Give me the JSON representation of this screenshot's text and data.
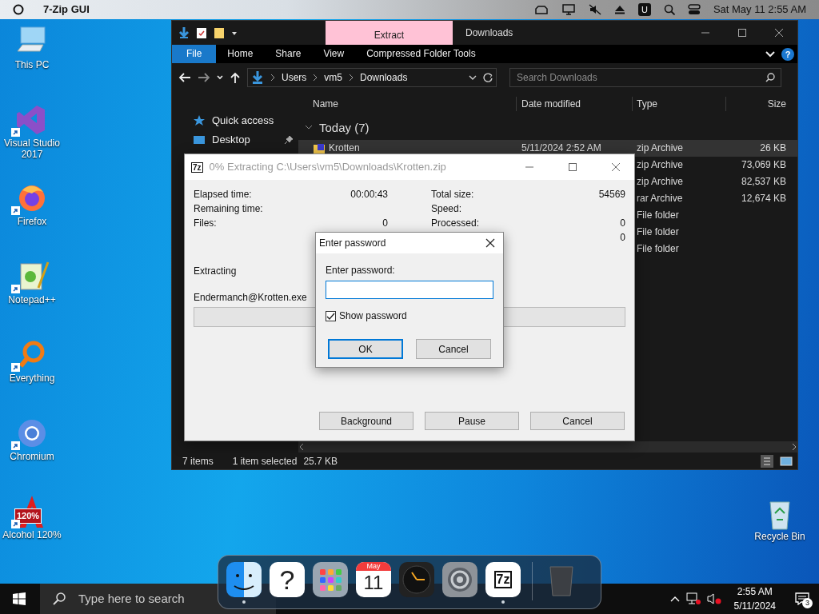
{
  "menubar": {
    "app_name": "7-Zip GUI",
    "badge_letter": "U",
    "clock": "Sat May 11 2:55 AM"
  },
  "desktop_icons": [
    {
      "label": "This PC",
      "kind": "pc",
      "shortcut": false
    },
    {
      "label": "Visual Studio 2017",
      "kind": "vs",
      "shortcut": true
    },
    {
      "label": "Firefox",
      "kind": "firefox",
      "shortcut": true
    },
    {
      "label": "Notepad++",
      "kind": "notepad",
      "shortcut": true
    },
    {
      "label": "Everything",
      "kind": "everything",
      "shortcut": true
    },
    {
      "label": "Chromium",
      "kind": "chromium",
      "shortcut": true
    },
    {
      "label": "Alcohol 120%",
      "kind": "alcohol",
      "shortcut": true,
      "logo_text": "120%"
    }
  ],
  "recycle_bin": {
    "label": "Recycle Bin"
  },
  "explorer": {
    "context_tab": "Extract",
    "title": "Downloads",
    "ribbon_tabs": [
      {
        "label": "File",
        "kind": "file"
      },
      {
        "label": "Home",
        "kind": "tab"
      },
      {
        "label": "Share",
        "kind": "tab"
      },
      {
        "label": "View",
        "kind": "tab"
      },
      {
        "label": "Compressed Folder Tools",
        "kind": "tab"
      }
    ],
    "help_glyph": "?",
    "breadcrumb": [
      "Users",
      "vm5",
      "Downloads"
    ],
    "search": {
      "placeholder": "Search Downloads"
    },
    "nav": [
      {
        "label": "Quick access",
        "kind": "star",
        "pinned": false
      },
      {
        "label": "Desktop",
        "kind": "desktop",
        "pinned": true
      }
    ],
    "columns": [
      "Name",
      "Date modified",
      "Type",
      "Size"
    ],
    "group": "Today (7)",
    "rows": [
      {
        "name": "Krotten",
        "date": "5/11/2024 2:52 AM",
        "type": "zip Archive",
        "size": "26 KB",
        "selected": true
      },
      {
        "type": "zip Archive",
        "size": "73,069 KB",
        "selected": false
      },
      {
        "type": "zip Archive",
        "size": "82,537 KB",
        "selected": false
      },
      {
        "type": "rar Archive",
        "size": "12,674 KB",
        "selected": false
      },
      {
        "type": "File folder",
        "selected": false
      },
      {
        "type": "File folder",
        "selected": false
      },
      {
        "type": "File folder",
        "selected": false
      }
    ],
    "status": {
      "count": "7 items",
      "selection": "1 item selected",
      "size": "25.7 KB"
    }
  },
  "extract_dialog": {
    "icon_text": "7z",
    "title": "0% Extracting C:\\Users\\vm5\\Downloads\\Krotten.zip",
    "left_stats": [
      {
        "label": "Elapsed time:",
        "value": "00:00:43"
      },
      {
        "label": "Remaining time:"
      },
      {
        "label": "Files:",
        "value": "0"
      }
    ],
    "right_stats": [
      {
        "label": "Total size:",
        "value": "54569"
      },
      {
        "label": "Speed:"
      },
      {
        "label": "Processed:",
        "value": "0"
      },
      {
        "value": "0"
      }
    ],
    "operation": "Extracting",
    "file": "Endermanch@Krotten.exe",
    "progress": {
      "level": 0
    },
    "buttons": [
      "Background",
      "Pause",
      "Cancel"
    ]
  },
  "password_dialog": {
    "title": "Enter password",
    "label": "Enter password:",
    "show_password": {
      "label": "Show password",
      "checked": true
    },
    "buttons": [
      {
        "label": "OK",
        "default": true
      },
      {
        "label": "Cancel",
        "default": false
      }
    ]
  },
  "dock": {
    "items": [
      {
        "kind": "finder",
        "running": true
      },
      {
        "kind": "help",
        "glyph": "?",
        "running": false
      },
      {
        "kind": "launchpad",
        "running": false
      },
      {
        "kind": "calendar",
        "month": "May",
        "day": "11",
        "running": false
      },
      {
        "kind": "clock",
        "running": false
      },
      {
        "kind": "settings",
        "running": false
      },
      {
        "kind": "sevenzip",
        "logo_text": "7z",
        "running": true
      },
      {
        "kind": "separator"
      },
      {
        "kind": "trash",
        "running": false
      }
    ]
  },
  "taskbar": {
    "search_placeholder": "Type here to search",
    "time": "2:55 AM",
    "date": "5/11/2024",
    "notification_count": "3"
  }
}
